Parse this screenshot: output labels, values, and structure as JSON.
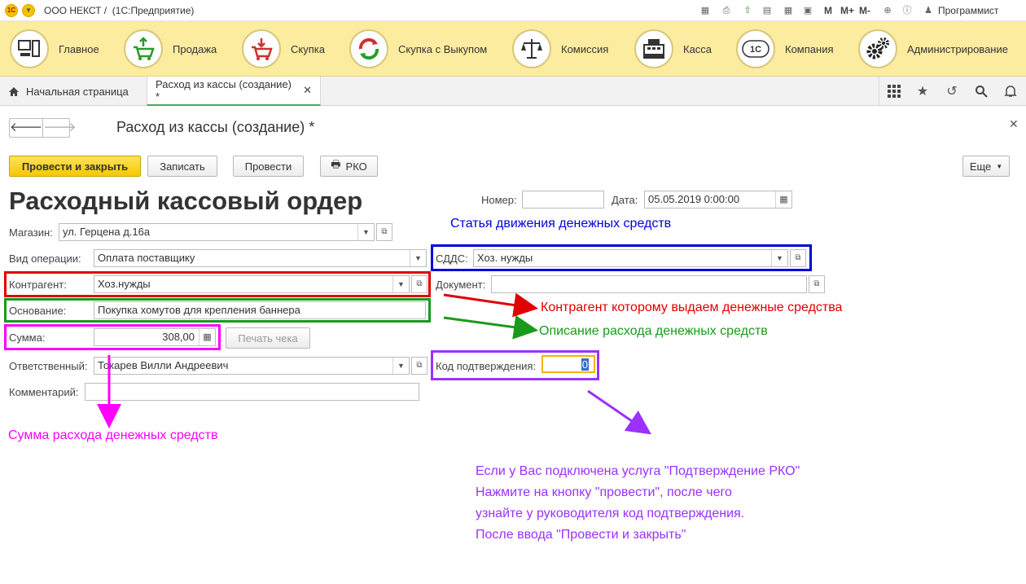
{
  "titlebar": {
    "title": "ООО НЕКСТ /  (1С:Предприятие)",
    "logo": "1С",
    "m": "M",
    "m_plus": "M+",
    "m_minus": "M-",
    "user": "Программист"
  },
  "sections": [
    {
      "label": "Главное",
      "icon": "computer-icon"
    },
    {
      "label": "Продажа",
      "icon": "cart-up-icon"
    },
    {
      "label": "Скупка",
      "icon": "cart-down-icon"
    },
    {
      "label": "Скупка с Выкупом",
      "icon": "recycle-icon"
    },
    {
      "label": "Комиссия",
      "icon": "scales-icon"
    },
    {
      "label": "Касса",
      "icon": "cash-register-icon"
    },
    {
      "label": "Компания",
      "icon": "company-logo-icon"
    },
    {
      "label": "Администрирование",
      "icon": "gears-icon"
    }
  ],
  "tabs": {
    "home": "Начальная страница",
    "active": "Расход из кассы (создание) *"
  },
  "form": {
    "title": "Расход из кассы (создание) *",
    "buttons": {
      "post_close": "Провести и закрыть",
      "save": "Записать",
      "post": "Провести",
      "rko": "РКО",
      "more": "Еще"
    },
    "doc_title": "Расходный кассовый ордер",
    "number_label": "Номер:",
    "number_value": "",
    "date_label": "Дата:",
    "date_value": "05.05.2019  0:00:00",
    "store_label": "Магазин:",
    "store_value": "ул. Герцена д.16а",
    "optype_label": "Вид операции:",
    "optype_value": "Оплата поставщику",
    "sdds_label": "СДДС:",
    "sdds_value": "Хоз. нужды",
    "contractor_label": "Контрагент:",
    "contractor_value": "Хоз.нужды",
    "document_label": "Документ:",
    "document_value": "",
    "basis_label": "Основание:",
    "basis_value": "Покупка хомутов для крепления баннера",
    "sum_label": "Сумма:",
    "sum_value": "308,00",
    "print_check": "Печать чека",
    "responsible_label": "Ответственный:",
    "responsible_value": "Токарев Вилли Андреевич",
    "code_label": "Код подтверждения:",
    "code_value": "0",
    "comment_label": "Комментарий:",
    "comment_value": ""
  },
  "annotations": {
    "sdds": "Статья движения денежных средств",
    "contractor": "Контрагент которому выдаем денежные средства",
    "basis": "Описание расхода денежных средств",
    "sum": "Сумма расхода денежных средств",
    "code_lines": [
      "Если у Вас подключена услуга \"Подтверждение РКО\"",
      "Нажмите на кнопку \"провести\", после чего",
      "узнайте у руководителя код подтверждения.",
      "После ввода \"Провести и закрыть\""
    ]
  },
  "colors": {
    "red": "#e00000",
    "green": "#1a9a1a",
    "blue": "#0000dd",
    "magenta": "#ff00ff",
    "purple": "#9b30ff",
    "yellow": "#fbeca0"
  }
}
